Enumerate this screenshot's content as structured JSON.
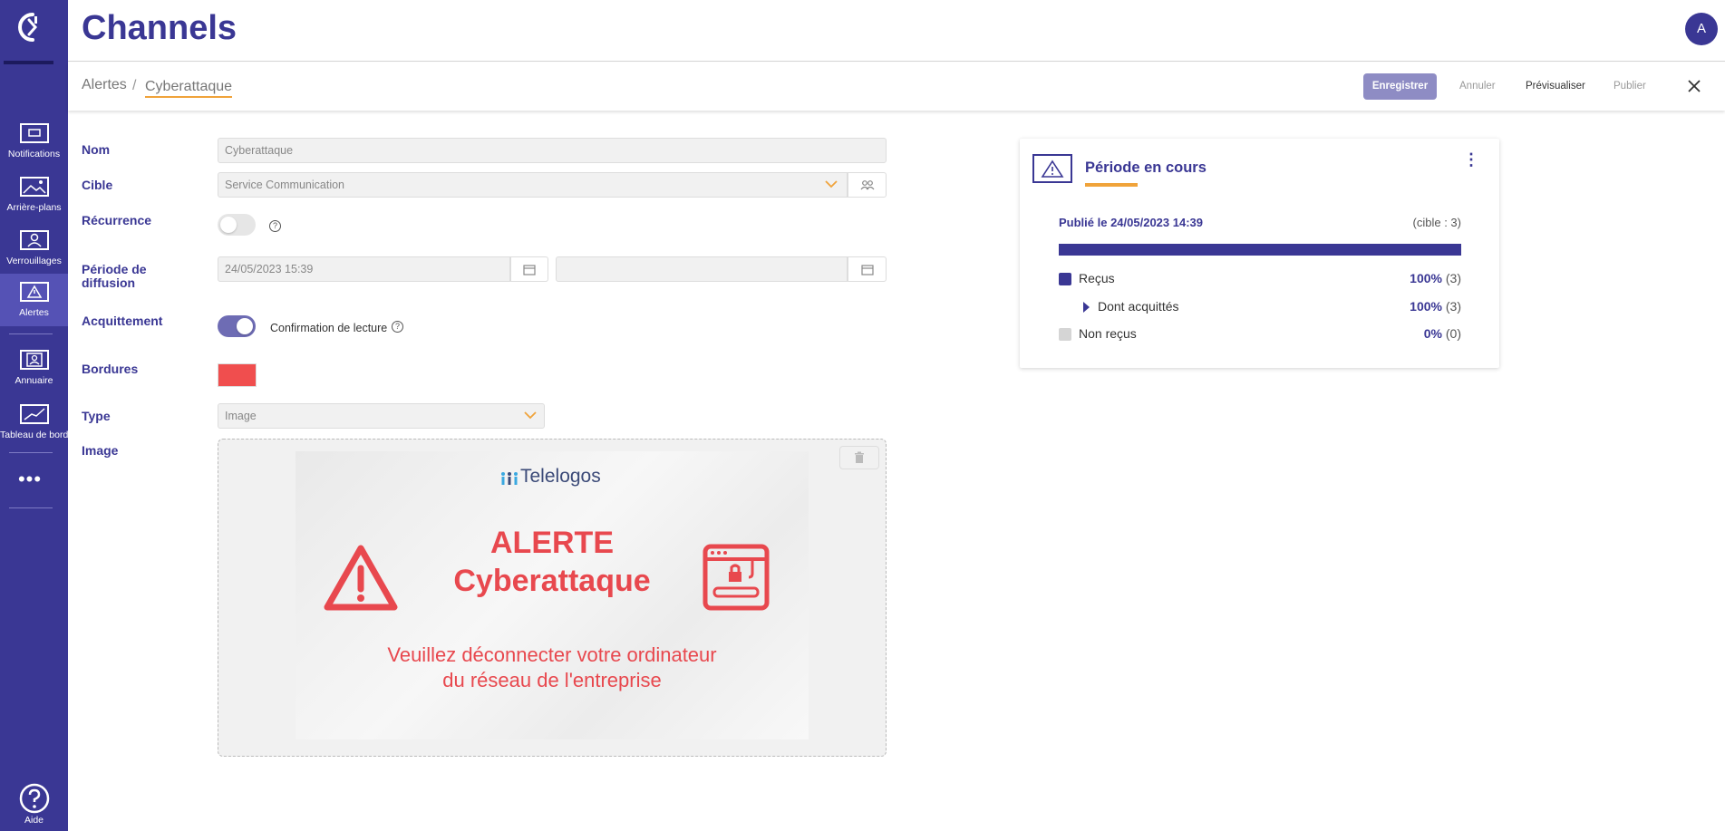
{
  "app": {
    "title": "Channels",
    "avatar_initial": "A"
  },
  "sidebar": {
    "items": [
      {
        "label": "Notifications",
        "icon": "notifications-icon"
      },
      {
        "label": "Arrière-plans",
        "icon": "backgrounds-icon"
      },
      {
        "label": "Verrouillages",
        "icon": "lock-screen-icon"
      },
      {
        "label": "Alertes",
        "icon": "alert-icon",
        "active": true
      },
      {
        "label": "Annuaire",
        "icon": "directory-icon"
      },
      {
        "label": "Tableau de bord",
        "icon": "dashboard-icon"
      }
    ],
    "more": "•••",
    "help_label": "Aide"
  },
  "breadcrumb": {
    "root": "Alertes",
    "separator": "/",
    "current": "Cyberattaque"
  },
  "toolbar": {
    "save_label": "Enregistrer",
    "cancel_label": "Annuler",
    "preview_label": "Prévisualiser",
    "publish_label": "Publier"
  },
  "form": {
    "name": {
      "label": "Nom",
      "value": "Cyberattaque"
    },
    "target": {
      "label": "Cible",
      "value": "Service Communication"
    },
    "recurrence": {
      "label": "Récurrence",
      "enabled": false,
      "help": "?"
    },
    "period": {
      "label_line1": "Période de",
      "label_line2": "diffusion",
      "start": "24/05/2023 15:39",
      "end": ""
    },
    "ack": {
      "label": "Acquittement",
      "enabled": true,
      "option_label": "Confirmation de lecture",
      "help": "?"
    },
    "borders": {
      "label": "Bordures",
      "color": "#f04e4e"
    },
    "type": {
      "label": "Type",
      "value": "Image"
    },
    "image": {
      "label": "Image",
      "brand": "Telelogos",
      "title_line1": "ALERTE",
      "title_line2": "Cyberattaque",
      "message_line1": "Veuillez déconnecter votre ordinateur",
      "message_line2": "du réseau de l'entreprise"
    }
  },
  "stats": {
    "title": "Période en cours",
    "published": "Publié le 24/05/2023 14:39",
    "target_count": "(cible : 3)",
    "progress": 1.0,
    "rows": [
      {
        "label": "Reçus",
        "percent": "100%",
        "count": "(3)",
        "color": "#3a3794"
      },
      {
        "label": "Dont acquittés",
        "percent": "100%",
        "count": "(3)"
      },
      {
        "label": "Non reçus",
        "percent": "0%",
        "count": "(0)",
        "color": "#d5d5d5"
      }
    ]
  },
  "colors": {
    "primary": "#3a3794",
    "accent": "#f0a33a",
    "alert_red": "#e8484e"
  }
}
